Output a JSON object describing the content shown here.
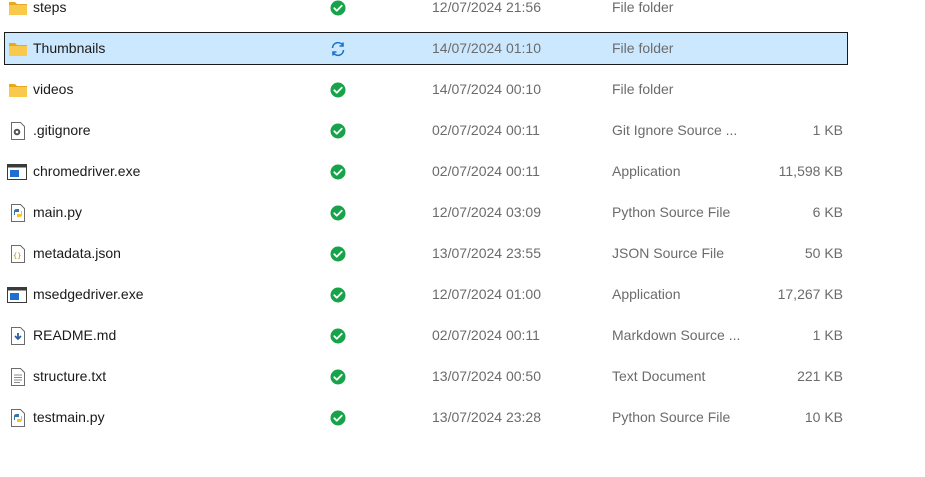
{
  "files": [
    {
      "name": "steps",
      "icon": "folder-icon",
      "status": "synced",
      "date": "12/07/2024 21:56",
      "type": "File folder",
      "size": ""
    },
    {
      "name": "Thumbnails",
      "icon": "folder-icon",
      "status": "syncing",
      "date": "14/07/2024 01:10",
      "type": "File folder",
      "size": "",
      "selected": true
    },
    {
      "name": "videos",
      "icon": "folder-icon",
      "status": "synced",
      "date": "14/07/2024 00:10",
      "type": "File folder",
      "size": ""
    },
    {
      "name": ".gitignore",
      "icon": "config-file-icon",
      "status": "synced",
      "date": "02/07/2024 00:11",
      "type": "Git Ignore Source ...",
      "size": "1 KB"
    },
    {
      "name": "chromedriver.exe",
      "icon": "application-icon",
      "status": "synced",
      "date": "02/07/2024 00:11",
      "type": "Application",
      "size": "11,598 KB"
    },
    {
      "name": "main.py",
      "icon": "python-file-icon",
      "status": "synced",
      "date": "12/07/2024 03:09",
      "type": "Python Source File",
      "size": "6 KB"
    },
    {
      "name": "metadata.json",
      "icon": "json-file-icon",
      "status": "synced",
      "date": "13/07/2024 23:55",
      "type": "JSON Source File",
      "size": "50 KB"
    },
    {
      "name": "msedgedriver.exe",
      "icon": "application-icon",
      "status": "synced",
      "date": "12/07/2024 01:00",
      "type": "Application",
      "size": "17,267 KB"
    },
    {
      "name": "README.md",
      "icon": "markdown-file-icon",
      "status": "synced",
      "date": "02/07/2024 00:11",
      "type": "Markdown Source ...",
      "size": "1 KB"
    },
    {
      "name": "structure.txt",
      "icon": "text-file-icon",
      "status": "synced",
      "date": "13/07/2024 00:50",
      "type": "Text Document",
      "size": "221 KB"
    },
    {
      "name": "testmain.py",
      "icon": "python-file-icon",
      "status": "synced",
      "date": "13/07/2024 23:28",
      "type": "Python Source File",
      "size": "10 KB"
    }
  ],
  "colors": {
    "selection_bg": "#cce8ff",
    "synced_green": "#16a34a",
    "syncing_blue": "#1a73c9",
    "folder_yellow": "#f4c542",
    "secondary_text": "#6b6b6b"
  }
}
